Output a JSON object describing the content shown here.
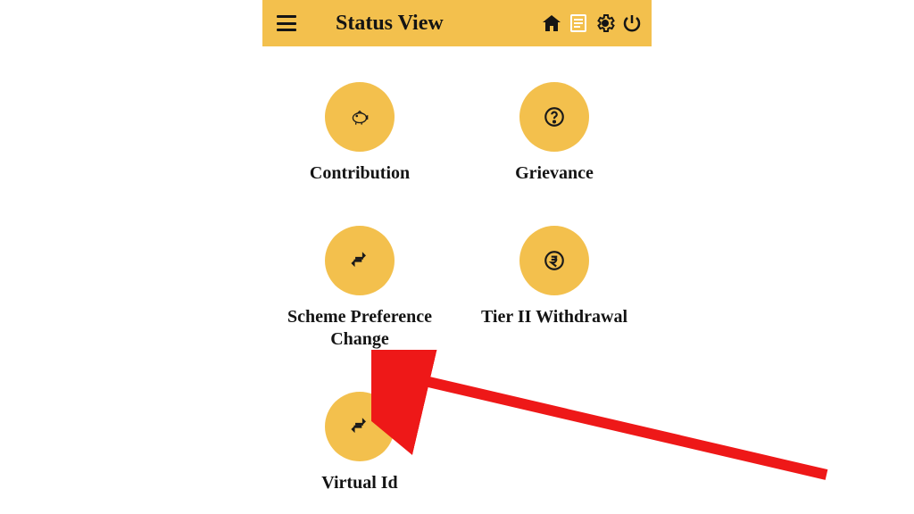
{
  "header": {
    "title": "Status View"
  },
  "menu": {
    "items": [
      {
        "label": "Contribution",
        "icon": "piggy"
      },
      {
        "label": "Grievance",
        "icon": "question"
      },
      {
        "label": "Scheme Preference Change",
        "icon": "arrows"
      },
      {
        "label": "Tier II Withdrawal",
        "icon": "rupee"
      },
      {
        "label": "Virtual Id",
        "icon": "arrows"
      }
    ]
  },
  "annotation": {
    "color": "#ee1818",
    "points_to": "virtual-id"
  }
}
